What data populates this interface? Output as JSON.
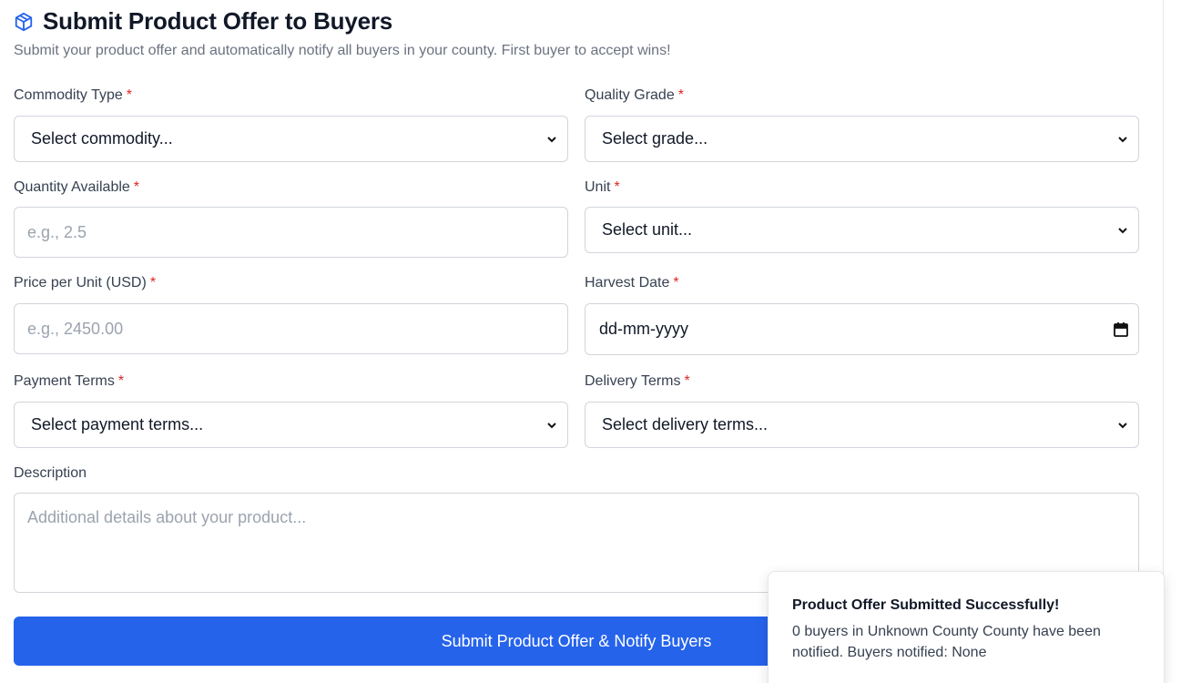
{
  "header": {
    "title": "Submit Product Offer to Buyers",
    "subtitle": "Submit your product offer and automatically notify all buyers in your county. First buyer to accept wins!",
    "icon": "package-icon"
  },
  "form": {
    "required_marker": "*",
    "commodity": {
      "label": "Commodity Type",
      "value": "Select commodity..."
    },
    "grade": {
      "label": "Quality Grade",
      "value": "Select grade..."
    },
    "quantity": {
      "label": "Quantity Available",
      "placeholder": "e.g., 2.5"
    },
    "unit": {
      "label": "Unit",
      "value": "Select unit..."
    },
    "price": {
      "label": "Price per Unit (USD)",
      "placeholder": "e.g., 2450.00"
    },
    "harvest": {
      "label": "Harvest Date",
      "value": "dd-mm-yyyy"
    },
    "payment": {
      "label": "Payment Terms",
      "value": "Select payment terms..."
    },
    "delivery": {
      "label": "Delivery Terms",
      "value": "Select delivery terms..."
    },
    "description": {
      "label": "Description",
      "placeholder": "Additional details about your product..."
    },
    "submit_label": "Submit Product Offer & Notify Buyers"
  },
  "toast": {
    "title": "Product Offer Submitted Successfully!",
    "message": "0 buyers in Unknown County County have been notified. Buyers notified: None"
  },
  "colors": {
    "accent": "#2563eb",
    "required": "#dc2626",
    "border": "#d1d5db"
  }
}
